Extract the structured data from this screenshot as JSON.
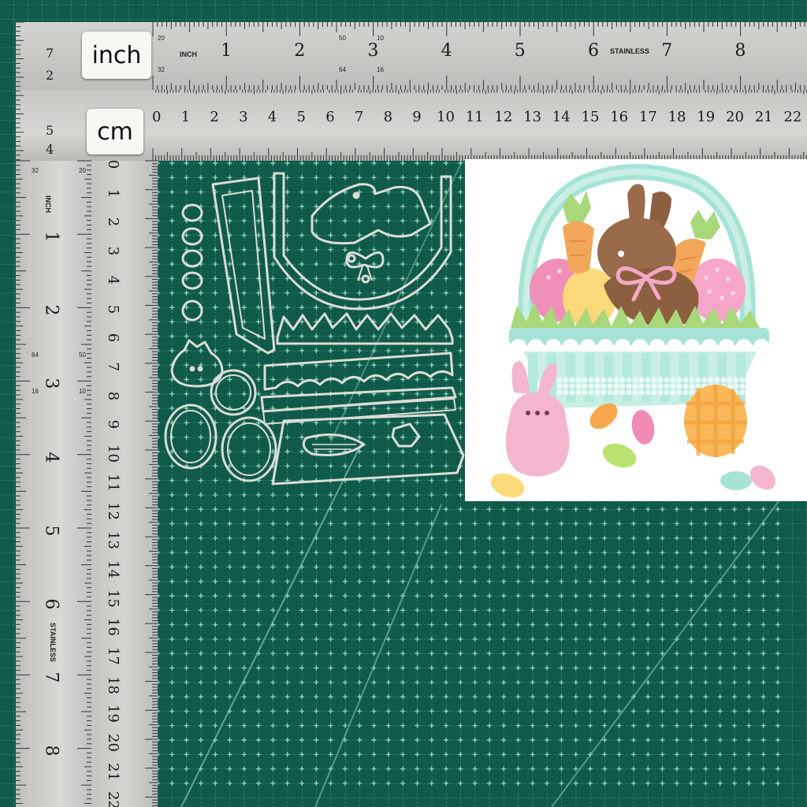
{
  "labels": {
    "inch": "inch",
    "cm": "cm"
  },
  "ruler_top_inch": {
    "unit_label": "INCH",
    "brand": "STAINLESS",
    "numbers": [
      "1",
      "2",
      "3",
      "4",
      "5",
      "6",
      "7",
      "8"
    ],
    "small_marks": [
      "20",
      "32",
      "50",
      "64",
      "10",
      "16"
    ]
  },
  "ruler_top_cm": {
    "numbers": [
      "0",
      "1",
      "2",
      "3",
      "4",
      "5",
      "6",
      "7",
      "8",
      "9",
      "10",
      "11",
      "12",
      "13",
      "14",
      "15",
      "16",
      "17",
      "18",
      "19",
      "20",
      "21",
      "22"
    ]
  },
  "ruler_top_left_corner": {
    "numbers": [
      "7",
      "2",
      "5",
      "4"
    ]
  },
  "ruler_left_inch": {
    "unit_label": "INCH",
    "brand": "STAINLESS",
    "numbers": [
      "1",
      "2",
      "3",
      "4",
      "5",
      "6",
      "7",
      "8"
    ],
    "small_marks": [
      "32",
      "20",
      "64",
      "50",
      "16",
      "10"
    ]
  },
  "ruler_left_cm": {
    "numbers": [
      "0",
      "1",
      "2",
      "3",
      "4",
      "5",
      "6",
      "7",
      "8",
      "9",
      "10",
      "11",
      "12",
      "13",
      "14",
      "15",
      "16",
      "17",
      "18",
      "19",
      "20",
      "21",
      "22"
    ]
  },
  "colors": {
    "mat": "#0f5a48",
    "grid": "#6fb8a2",
    "ruler": "#c9c9c6",
    "die": "#d9d9d6",
    "basket": "#a6e3d6",
    "bunny_brown": "#9a6b4a",
    "bow_pink": "#f4a8c4",
    "carrot": "#f2a65a",
    "leaf": "#a8d87a",
    "peep_pink": "#f4b6cf"
  }
}
